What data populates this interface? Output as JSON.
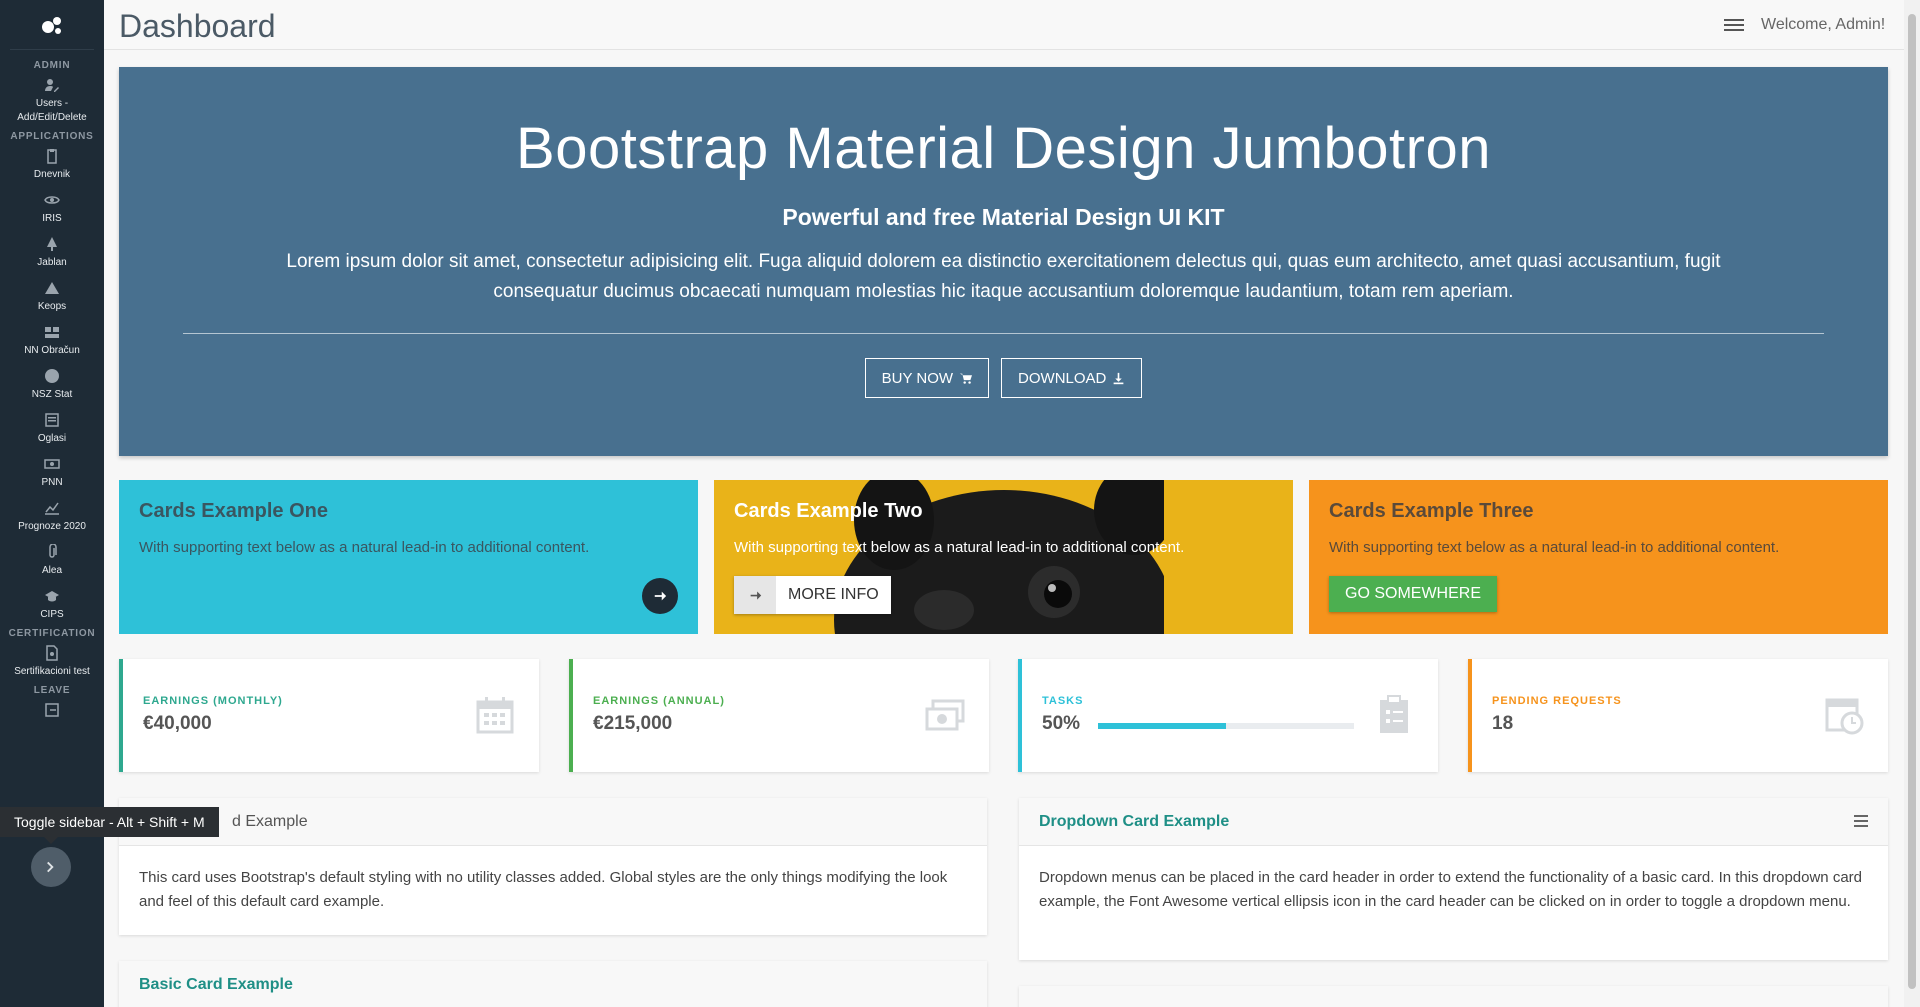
{
  "header": {
    "title": "Dashboard",
    "welcome": "Welcome, Admin!"
  },
  "sidebar": {
    "sections": {
      "admin": "ADMIN",
      "applications": "APPLICATIONS",
      "certification": "CERTIFICATION",
      "leave": "LEAVE"
    },
    "items": [
      {
        "label": "Users - Add/Edit/Delete",
        "icon": "user-edit-icon"
      },
      {
        "label": "Dnevnik",
        "icon": "clipboard-icon"
      },
      {
        "label": "IRIS",
        "icon": "eye-icon"
      },
      {
        "label": "Jablan",
        "icon": "tree-icon"
      },
      {
        "label": "Keops",
        "icon": "pyramid-icon"
      },
      {
        "label": "NN Obračun",
        "icon": "calculator-icon"
      },
      {
        "label": "NSZ Stat",
        "icon": "globe-icon"
      },
      {
        "label": "Oglasi",
        "icon": "newspaper-icon"
      },
      {
        "label": "PNN",
        "icon": "money-icon"
      },
      {
        "label": "Prognoze 2020",
        "icon": "chart-line-icon"
      },
      {
        "label": "Alea",
        "icon": "paperclip-icon"
      },
      {
        "label": "CIPS",
        "icon": "graduation-cap-icon"
      },
      {
        "label": "Sertifikacioni test",
        "icon": "certificate-icon"
      }
    ],
    "tooltip": "Toggle sidebar - Alt + Shift + M"
  },
  "jumbotron": {
    "title": "Bootstrap Material Design Jumbotron",
    "subtitle": "Powerful and free Material Design UI KIT",
    "text": "Lorem ipsum dolor sit amet, consectetur adipisicing elit. Fuga aliquid dolorem ea distinctio exercitationem delectus qui, quas eum architecto, amet quasi accusantium, fugit consequatur ducimus obcaecati numquam molestias hic itaque accusantium doloremque laudantium, totam rem aperiam.",
    "buy_label": "BUY NOW",
    "download_label": "DOWNLOAD",
    "bg_color": "#48708f"
  },
  "cards": [
    {
      "title": "Cards Example One",
      "text": "With supporting text below as a natural lead-in to additional content.",
      "color": "#2ec1d8"
    },
    {
      "title": "Cards Example Two",
      "text": "With supporting text below as a natural lead-in to additional content.",
      "button": "MORE INFO",
      "color": "#e9b319"
    },
    {
      "title": "Cards Example Three",
      "text": "With supporting text below as a natural lead-in to additional content.",
      "button": "GO SOMEWHERE",
      "color": "#f6931c"
    }
  ],
  "stats": [
    {
      "label": "EARNINGS (MONTHLY)",
      "value": "€40,000",
      "color": "#2ea88f",
      "icon": "calendar-icon"
    },
    {
      "label": "EARNINGS (ANNUAL)",
      "value": "€215,000",
      "color": "#4caf50",
      "icon": "money-bill-icon"
    },
    {
      "label": "TASKS",
      "value": "50%",
      "progress": 0.5,
      "color": "#2ec1d8",
      "icon": "clipboard-list-icon"
    },
    {
      "label": "PENDING REQUESTS",
      "value": "18",
      "color": "#f6931c",
      "icon": "clock-icon"
    }
  ],
  "panels": {
    "default_title": "d Example",
    "default_text": "This card uses Bootstrap's default styling with no utility classes added. Global styles are the only things modifying the look and feel of this default card example.",
    "dropdown_title": "Dropdown Card Example",
    "dropdown_text": "Dropdown menus can be placed in the card header in order to extend the functionality of a basic card. In this dropdown card example, the Font Awesome vertical ellipsis icon in the card header can be clicked on in order to toggle a dropdown menu.",
    "basic_title": "Basic Card Example"
  }
}
